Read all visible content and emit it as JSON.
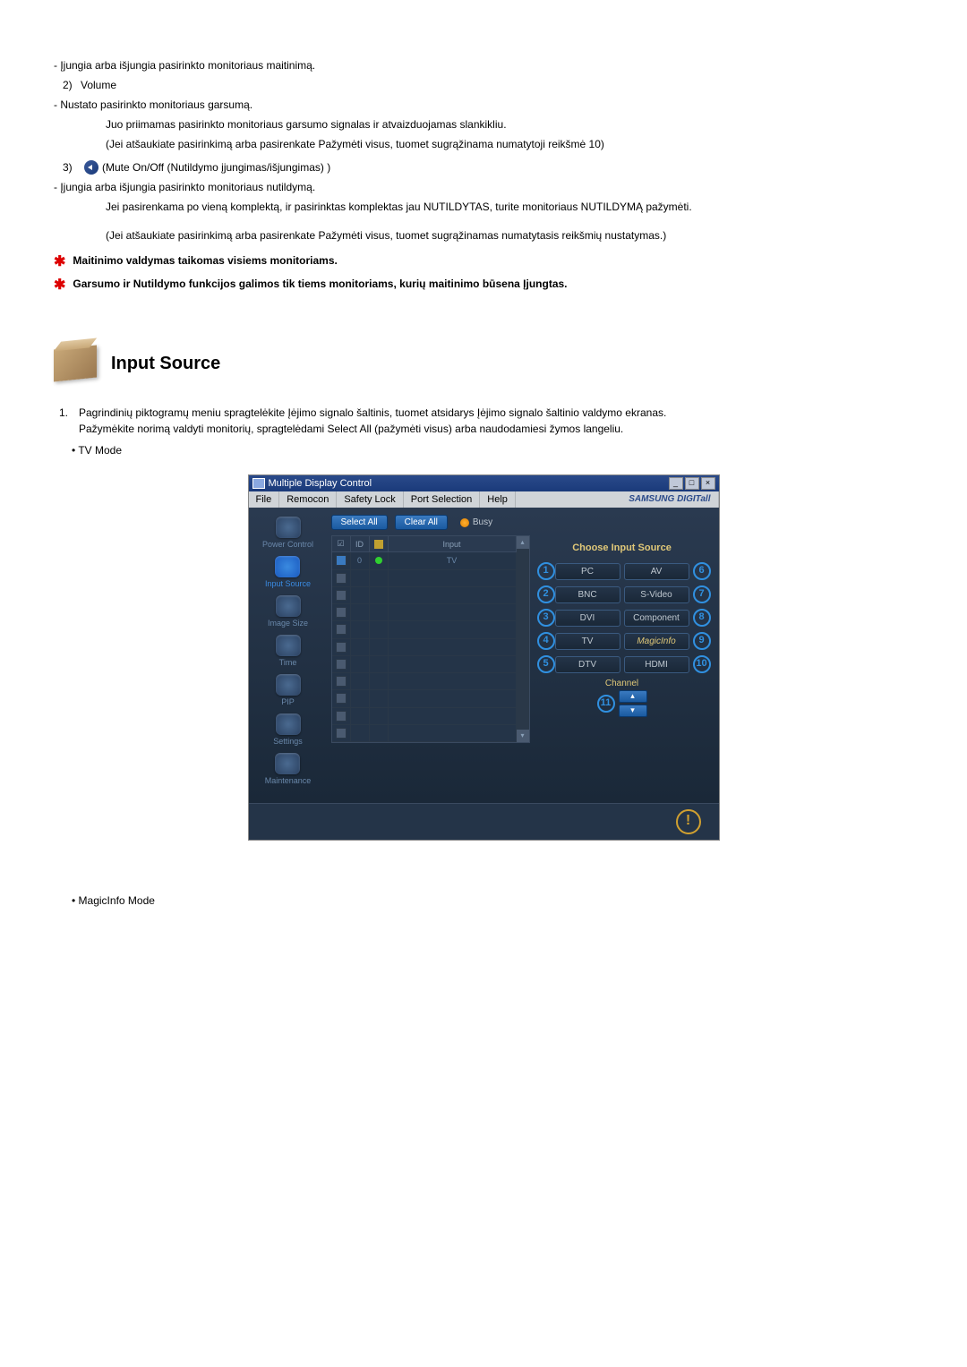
{
  "upper": {
    "power_desc": "- Įjungia arba išjungia pasirinkto monitoriaus maitinimą.",
    "vol_num": "2)",
    "vol_label": "Volume",
    "vol_l1": "- Nustato pasirinkto monitoriaus garsumą.",
    "vol_l2": "Juo priimamas pasirinkto monitoriaus garsumo signalas ir atvaizduojamas slankikliu.",
    "vol_l3": "(Jei atšaukiate pasirinkimą arba pasirenkate Pažymėti visus, tuomet sugrąžinama numatytoji reikšmė 10)",
    "mute_num": "3)",
    "mute_label": "(Mute On/Off (Nutildymo įjungimas/išjungimas) )",
    "mute_l1": "- Įjungia arba išjungia pasirinkto monitoriaus nutildymą.",
    "mute_l2": "Jei pasirenkama po vieną komplektą, ir pasirinktas komplektas jau NUTILDYTAS, turite monitoriaus NUTILDYMĄ pažymėti.",
    "mute_l3": "(Jei atšaukiate pasirinkimą arba pasirenkate Pažymėti visus, tuomet sugrąžinamas numatytasis reikšmių nustatymas.)",
    "note1": "Maitinimo valdymas taikomas visiems monitoriams.",
    "note2": "Garsumo ir Nutildymo funkcijos galimos tik tiems monitoriams, kurių maitinimo būsena Įjungtas."
  },
  "section": {
    "title": "Input Source",
    "step1_num": "1.",
    "step1_a": "Pagrindinių piktogramų meniu spragtelėkite Įėjimo signalo šaltinis, tuomet atsidarys Įėjimo signalo šaltinio valdymo ekranas.",
    "step1_b": "Pažymėkite norimą valdyti monitorių, spragtelėdami Select All (pažymėti visus) arba naudodamiesi žymos langeliu.",
    "bullet_tv": "TV Mode",
    "bullet_mi": "MagicInfo Mode"
  },
  "app": {
    "title": "Multiple Display Control",
    "menu": [
      "File",
      "Remocon",
      "Safety Lock",
      "Port Selection",
      "Help"
    ],
    "brand": "SAMSUNG DIGITall",
    "select_all": "Select All",
    "clear_all": "Clear All",
    "busy": "Busy",
    "sidebar": [
      {
        "label": "Power Control"
      },
      {
        "label": "Input Source"
      },
      {
        "label": "Image Size"
      },
      {
        "label": "Time"
      },
      {
        "label": "PIP"
      },
      {
        "label": "Settings"
      },
      {
        "label": "Maintenance"
      }
    ],
    "grid_head": {
      "chk": "☑",
      "id": "ID",
      "st": "",
      "input": "Input"
    },
    "row0": {
      "id": "0",
      "input": "TV"
    },
    "panel_title": "Choose Input Source",
    "sources_left": [
      "PC",
      "BNC",
      "DVI",
      "TV",
      "DTV"
    ],
    "sources_right": [
      "AV",
      "S-Video",
      "Component",
      "MagicInfo",
      "HDMI"
    ],
    "nums_left": [
      "1",
      "2",
      "3",
      "4",
      "5"
    ],
    "nums_right": [
      "6",
      "7",
      "8",
      "9",
      "10"
    ],
    "channel_label": "Channel",
    "ch_num": "11"
  }
}
